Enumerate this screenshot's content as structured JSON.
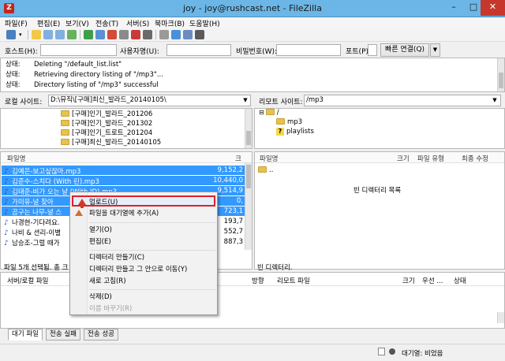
{
  "window": {
    "title": "joy - joy@rushcast.net - FileZilla",
    "app_icon": "Z",
    "btn_min": "–",
    "btn_max": "□",
    "btn_close": "✕"
  },
  "menu": [
    "파일(F)",
    "편집(E)",
    "보기(V)",
    "전송(T)",
    "서버(S)",
    "북마크(B)",
    "도움말(H)"
  ],
  "quickconnect": {
    "host_label": "호스트(H):",
    "user_label": "사용자명(U):",
    "pass_label": "비밀번호(W):",
    "port_label": "포트(P):",
    "button": "빠른 연결(Q)",
    "dropdown": "▼"
  },
  "log": [
    {
      "label": "상태:",
      "text": "Deleting \"/default_list.list\""
    },
    {
      "label": "상태:",
      "text": "Retrieving directory listing of \"/mp3\"..."
    },
    {
      "label": "상태:",
      "text": "Directory listing of \"/mp3\" successful"
    }
  ],
  "local": {
    "site_label": "로컬 사이트:",
    "path": "D:\\뮤직\\[구매]최신_발라드_20140105\\",
    "tree": [
      "[구매]인기_발라드_201206",
      "[구매]인기_발라드_201302",
      "[구매]인기_트로트_201204",
      "[구매]최신_발라드_20140105"
    ],
    "columns": {
      "name": "파일명",
      "size": "크"
    },
    "files": [
      {
        "name": "김예은-보고싶잖아.mp3",
        "size": "9,152,2",
        "selected": true
      },
      {
        "name": "김준수-스치다 (With 린).mp3",
        "size": "10,440,0",
        "selected": true
      },
      {
        "name": "김태준-비가 오는 날 (With JD).mp3",
        "size": "9,514,9",
        "selected": true
      },
      {
        "name": "가미유-널 찾아",
        "size": "0,",
        "selected": true
      },
      {
        "name": "곰구는 나무-널 스",
        "size": "723,1",
        "selected": true
      },
      {
        "name": "나경현-기다려요.",
        "size": "193,7",
        "selected": false
      },
      {
        "name": "나비 & 션리-이별",
        "size": "552,7",
        "selected": false
      },
      {
        "name": "남승조-그럴 때가",
        "size": "887,3",
        "selected": false
      }
    ],
    "status": "파일 5개 선택됨. 총 크"
  },
  "remote": {
    "site_label": "리모트 사이트:",
    "path": "/mp3",
    "tree": [
      "/",
      "mp3",
      "playlists"
    ],
    "columns": {
      "name": "파일명",
      "size": "크기",
      "type": "파일 유형",
      "modified": "최종 수정"
    },
    "parent": "..",
    "empty_text": "빈 디렉터리 목록",
    "status": "빈 디렉터리."
  },
  "queue": {
    "columns": {
      "local": "서버/로컬 파일",
      "direction": "방향",
      "remote": "리모트 파일",
      "size": "크기",
      "priority": "우선 ...",
      "status": "상태"
    },
    "tabs": [
      "대기 파일",
      "전송 실패",
      "전송 성공"
    ]
  },
  "statusbar": {
    "text": "대기열: 비었음"
  },
  "context_menu": {
    "items": [
      {
        "label": "업로드(U)",
        "highlighted": true
      },
      {
        "label": "파일을 대기열에 추가(A)"
      },
      {
        "label": "열기(O)"
      },
      {
        "label": "편집(E)"
      },
      {
        "label": "디렉터리 만들기(C)"
      },
      {
        "label": "디렉터리 만들고 그 안으로 이동(Y)"
      },
      {
        "label": "새로 고침(R)"
      },
      {
        "label": "삭제(D)"
      },
      {
        "label": "이름 바꾸기(R)",
        "disabled": true
      }
    ]
  }
}
